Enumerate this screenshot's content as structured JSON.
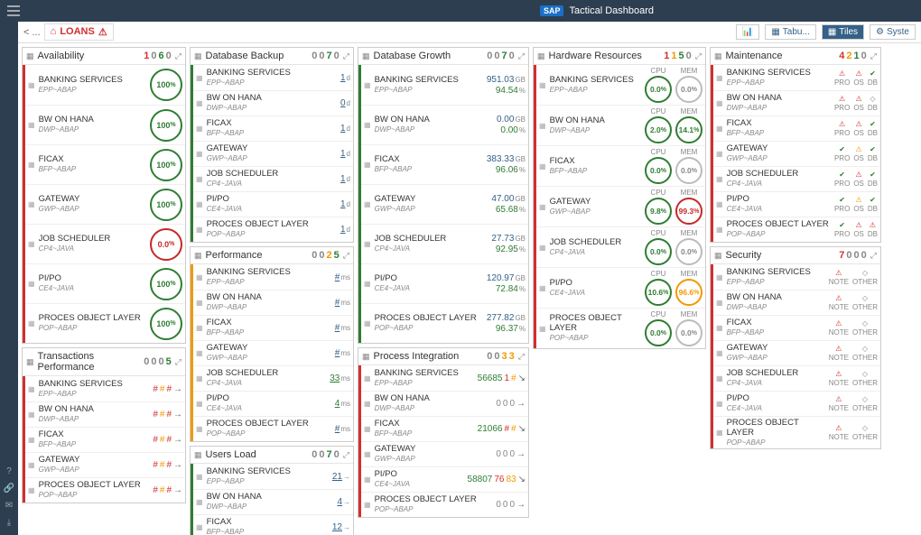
{
  "header": {
    "title": "Tactical Dashboard",
    "logo": "SAP"
  },
  "toolbar": {
    "back": "< ...",
    "loans": "LOANS",
    "tabu": "Tabu...",
    "tiles": "Tiles",
    "syste": "Syste"
  },
  "digits": {
    "availability": [
      "1",
      "0",
      "6",
      "0"
    ],
    "txperf": [
      "0",
      "0",
      "0",
      "5"
    ],
    "dbbackup": [
      "0",
      "0",
      "7",
      "0"
    ],
    "perf": [
      "0",
      "0",
      "2",
      "5"
    ],
    "users": [
      "0",
      "0",
      "7",
      "0"
    ],
    "dbgrowth": [
      "0",
      "0",
      "7",
      "0"
    ],
    "pi": [
      "0",
      "0",
      "3",
      "3"
    ],
    "hw": [
      "1",
      "1",
      "5",
      "0"
    ],
    "maint": [
      "4",
      "2",
      "1",
      "0"
    ],
    "sec": [
      "7",
      "0",
      "0",
      "0"
    ]
  },
  "panels": {
    "availability": {
      "title": "Availability",
      "stripe": "#d32f2f",
      "rows": [
        {
          "n": "BANKING SERVICES",
          "s": "EPP~ABAP",
          "v": "100",
          "u": "%",
          "c": "green"
        },
        {
          "n": "BW ON HANA",
          "s": "DWP~ABAP",
          "v": "100",
          "u": "%",
          "c": "green"
        },
        {
          "n": "FICAX",
          "s": "BFP~ABAP",
          "v": "100",
          "u": "%",
          "c": "green"
        },
        {
          "n": "GATEWAY",
          "s": "GWP~ABAP",
          "v": "100",
          "u": "%",
          "c": "green"
        },
        {
          "n": "JOB SCHEDULER",
          "s": "CP4~JAVA",
          "v": "0.0",
          "u": "%",
          "c": "red"
        },
        {
          "n": "PI/PO",
          "s": "CE4~JAVA",
          "v": "100",
          "u": "%",
          "c": "green"
        },
        {
          "n": "PROCES OBJECT LAYER",
          "s": "POP~ABAP",
          "v": "100",
          "u": "%",
          "c": "green"
        }
      ]
    },
    "txperf": {
      "title": "Transactions Performance",
      "stripe": "#d32f2f",
      "rows": [
        {
          "n": "BANKING SERVICES",
          "s": "EPP~ABAP"
        },
        {
          "n": "BW ON HANA",
          "s": "DWP~ABAP"
        },
        {
          "n": "FICAX",
          "s": "BFP~ABAP"
        },
        {
          "n": "GATEWAY",
          "s": "GWP~ABAP"
        },
        {
          "n": "PROCES OBJECT LAYER",
          "s": "POP~ABAP"
        }
      ]
    },
    "dbbackup": {
      "title": "Database Backup",
      "stripe": "#2e7d32",
      "rows": [
        {
          "n": "BANKING SERVICES",
          "s": "EPP~ABAP",
          "v": "1",
          "u": "d"
        },
        {
          "n": "BW ON HANA",
          "s": "DWP~ABAP",
          "v": "0",
          "u": "d"
        },
        {
          "n": "FICAX",
          "s": "BFP~ABAP",
          "v": "1",
          "u": "d"
        },
        {
          "n": "GATEWAY",
          "s": "GWP~ABAP",
          "v": "1",
          "u": "d"
        },
        {
          "n": "JOB SCHEDULER",
          "s": "CP4~JAVA",
          "v": "1",
          "u": "d"
        },
        {
          "n": "PI/PO",
          "s": "CE4~JAVA",
          "v": "1",
          "u": "d"
        },
        {
          "n": "PROCES OBJECT LAYER",
          "s": "POP~ABAP",
          "v": "1",
          "u": "d"
        }
      ]
    },
    "perf": {
      "title": "Performance",
      "stripe": "#ef9a00",
      "rows": [
        {
          "n": "BANKING SERVICES",
          "s": "EPP~ABAP",
          "v": "#",
          "u": "ms"
        },
        {
          "n": "BW ON HANA",
          "s": "DWP~ABAP",
          "v": "#",
          "u": "ms"
        },
        {
          "n": "FICAX",
          "s": "BFP~ABAP",
          "v": "#",
          "u": "ms"
        },
        {
          "n": "GATEWAY",
          "s": "GWP~ABAP",
          "v": "#",
          "u": "ms"
        },
        {
          "n": "JOB SCHEDULER",
          "s": "CP4~JAVA",
          "v": "33",
          "u": "ms",
          "c": "green"
        },
        {
          "n": "PI/PO",
          "s": "CE4~JAVA",
          "v": "4",
          "u": "ms",
          "c": "green"
        },
        {
          "n": "PROCES OBJECT LAYER",
          "s": "POP~ABAP",
          "v": "#",
          "u": "ms"
        }
      ]
    },
    "users": {
      "title": "Users Load",
      "stripe": "#2e7d32",
      "rows": [
        {
          "n": "BANKING SERVICES",
          "s": "EPP~ABAP",
          "v": "21"
        },
        {
          "n": "BW ON HANA",
          "s": "DWP~ABAP",
          "v": "4"
        },
        {
          "n": "FICAX",
          "s": "BFP~ABAP",
          "v": "12"
        }
      ]
    },
    "dbgrowth": {
      "title": "Database Growth",
      "stripe": "#2e7d32",
      "rows": [
        {
          "n": "BANKING SERVICES",
          "s": "EPP~ABAP",
          "a": "951.03",
          "au": "GB",
          "b": "94.54",
          "bu": "%"
        },
        {
          "n": "BW ON HANA",
          "s": "DWP~ABAP",
          "a": "0.00",
          "au": "GB",
          "b": "0.00",
          "bu": "%"
        },
        {
          "n": "FICAX",
          "s": "BFP~ABAP",
          "a": "383.33",
          "au": "GB",
          "b": "96.06",
          "bu": "%"
        },
        {
          "n": "GATEWAY",
          "s": "GWP~ABAP",
          "a": "47.00",
          "au": "GB",
          "b": "65.68",
          "bu": "%"
        },
        {
          "n": "JOB SCHEDULER",
          "s": "CP4~JAVA",
          "a": "27.73",
          "au": "GB",
          "b": "92.95",
          "bu": "%"
        },
        {
          "n": "PI/PO",
          "s": "CE4~JAVA",
          "a": "120.97",
          "au": "GB",
          "b": "72.84",
          "bu": "%"
        },
        {
          "n": "PROCES OBJECT LAYER",
          "s": "POP~ABAP",
          "a": "277.82",
          "au": "GB",
          "b": "96.37",
          "bu": "%"
        }
      ]
    },
    "pi": {
      "title": "Process Integration",
      "stripe": "#d32f2f",
      "rows": [
        {
          "n": "BANKING SERVICES",
          "s": "EPP~ABAP",
          "t": [
            "56685",
            "1",
            "#"
          ],
          "tc": [
            "green",
            "red",
            "orange"
          ],
          "ar": "↘"
        },
        {
          "n": "BW ON HANA",
          "s": "DWP~ABAP",
          "t": [
            "0",
            "0",
            "0"
          ],
          "tc": [
            "grey",
            "grey",
            "grey"
          ],
          "ar": "→"
        },
        {
          "n": "FICAX",
          "s": "BFP~ABAP",
          "t": [
            "21066",
            "#",
            "#"
          ],
          "tc": [
            "green",
            "red",
            "orange"
          ],
          "ar": "↘"
        },
        {
          "n": "GATEWAY",
          "s": "GWP~ABAP",
          "t": [
            "0",
            "0",
            "0"
          ],
          "tc": [
            "grey",
            "grey",
            "grey"
          ],
          "ar": "→"
        },
        {
          "n": "PI/PO",
          "s": "CE4~JAVA",
          "t": [
            "58807",
            "76",
            "83"
          ],
          "tc": [
            "green",
            "red",
            "orange"
          ],
          "ar": "↘"
        },
        {
          "n": "PROCES OBJECT LAYER",
          "s": "POP~ABAP",
          "t": [
            "0",
            "0",
            "0"
          ],
          "tc": [
            "grey",
            "grey",
            "grey"
          ],
          "ar": "→"
        }
      ]
    },
    "hw": {
      "title": "Hardware Resources",
      "stripe": "#d32f2f",
      "h": [
        "CPU",
        "MEM"
      ],
      "rows": [
        {
          "n": "BANKING SERVICES",
          "s": "EPP~ABAP",
          "cpu": "0.0",
          "cpuc": "green",
          "mem": "0.0",
          "memc": "grey"
        },
        {
          "n": "BW ON HANA",
          "s": "DWP~ABAP",
          "cpu": "2.0",
          "cpuc": "green",
          "mem": "14.1",
          "memc": "green"
        },
        {
          "n": "FICAX",
          "s": "BFP~ABAP",
          "cpu": "0.0",
          "cpuc": "green",
          "mem": "0.0",
          "memc": "grey"
        },
        {
          "n": "GATEWAY",
          "s": "GWP~ABAP",
          "cpu": "9.8",
          "cpuc": "green",
          "mem": "99.3",
          "memc": "red"
        },
        {
          "n": "JOB SCHEDULER",
          "s": "CP4~JAVA",
          "cpu": "0.0",
          "cpuc": "green",
          "mem": "0.0",
          "memc": "grey"
        },
        {
          "n": "PI/PO",
          "s": "CE4~JAVA",
          "cpu": "10.6",
          "cpuc": "green",
          "mem": "96.6",
          "memc": "orange"
        },
        {
          "n": "PROCES OBJECT LAYER",
          "s": "POP~ABAP",
          "cpu": "0.0",
          "cpuc": "green",
          "mem": "0.0",
          "memc": "grey"
        }
      ]
    },
    "maint": {
      "title": "Maintenance",
      "stripe": "#d32f2f",
      "h": [
        "PRO",
        "OS",
        "DB"
      ],
      "rows": [
        {
          "n": "BANKING SERVICES",
          "s": "EPP~ABAP",
          "i": [
            "warn",
            "warn",
            "ok"
          ]
        },
        {
          "n": "BW ON HANA",
          "s": "DWP~ABAP",
          "i": [
            "warn",
            "warn",
            "diam"
          ]
        },
        {
          "n": "FICAX",
          "s": "BFP~ABAP",
          "i": [
            "warn",
            "warn",
            "ok"
          ]
        },
        {
          "n": "GATEWAY",
          "s": "GWP~ABAP",
          "i": [
            "ok",
            "warny",
            "ok"
          ]
        },
        {
          "n": "JOB SCHEDULER",
          "s": "CP4~JAVA",
          "i": [
            "ok",
            "warn",
            "ok"
          ]
        },
        {
          "n": "PI/PO",
          "s": "CE4~JAVA",
          "i": [
            "ok",
            "warny",
            "ok"
          ]
        },
        {
          "n": "PROCES OBJECT LAYER",
          "s": "POP~ABAP",
          "i": [
            "ok",
            "warn",
            "warn"
          ]
        }
      ]
    },
    "sec": {
      "title": "Security",
      "stripe": "#d32f2f",
      "h": [
        "NOTE",
        "OTHER"
      ],
      "rows": [
        {
          "n": "BANKING SERVICES",
          "s": "EPP~ABAP",
          "i": [
            "warn",
            "diam"
          ]
        },
        {
          "n": "BW ON HANA",
          "s": "DWP~ABAP",
          "i": [
            "warn",
            "diam"
          ]
        },
        {
          "n": "FICAX",
          "s": "BFP~ABAP",
          "i": [
            "warn",
            "diam"
          ]
        },
        {
          "n": "GATEWAY",
          "s": "GWP~ABAP",
          "i": [
            "warn",
            "diam"
          ]
        },
        {
          "n": "JOB SCHEDULER",
          "s": "CP4~JAVA",
          "i": [
            "warn",
            "diam"
          ]
        },
        {
          "n": "PI/PO",
          "s": "CE4~JAVA",
          "i": [
            "warn",
            "diam"
          ]
        },
        {
          "n": "PROCES OBJECT LAYER",
          "s": "POP~ABAP",
          "i": [
            "warn",
            "diam"
          ]
        }
      ]
    }
  }
}
